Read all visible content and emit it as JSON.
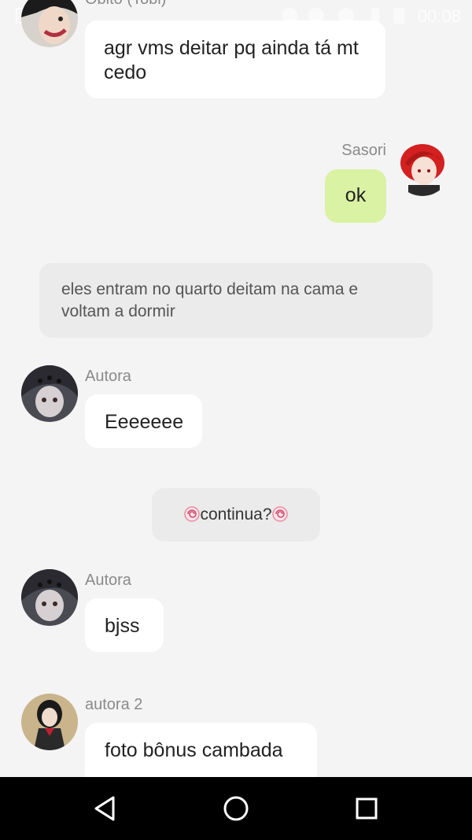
{
  "status_bar": {
    "time": "00:08"
  },
  "messages": [
    {
      "name": "Obito (Tobi)",
      "text": "agr vms deitar pq ainda tá mt cedo",
      "side": "left"
    },
    {
      "name": "Sasori",
      "text": "ok",
      "side": "right"
    },
    {
      "narration": "eles entram no quarto deitam na cama e voltam a dormir"
    },
    {
      "name": "Autora",
      "text": "Eeeeeee",
      "side": "left"
    },
    {
      "narration": "continua?"
    },
    {
      "name": "Autora",
      "text": "bjss",
      "side": "left"
    },
    {
      "name": "autora 2",
      "text": "foto bônus cambada",
      "side": "left"
    }
  ],
  "colors": {
    "background": "#f4f4f4",
    "bubble": "#ffffff",
    "my_bubble": "#d9f2a3",
    "narration": "#ebebeb",
    "name": "#8a8a8a",
    "nav_bar": "#000000"
  },
  "nav_bar": {
    "buttons": [
      "back-icon",
      "home-icon",
      "recents-icon"
    ]
  }
}
